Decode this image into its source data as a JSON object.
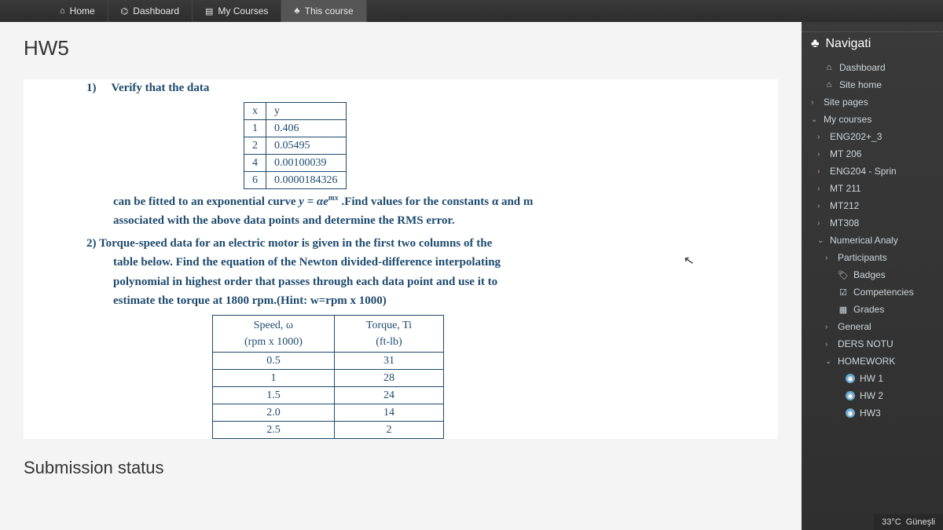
{
  "topnav": {
    "home": "Home",
    "dashboard": "Dashboard",
    "my_courses": "My Courses",
    "this_course": "This course"
  },
  "page_title": "HW5",
  "q1": {
    "num": "1)",
    "intro": "Verify that the data",
    "table": {
      "h1": "x",
      "h2": "y",
      "rows": [
        {
          "x": "1",
          "y": "0.406"
        },
        {
          "x": "2",
          "y": "0.05495"
        },
        {
          "x": "4",
          "y": "0.00100039"
        },
        {
          "x": "6",
          "y": "0.0000184326"
        }
      ]
    },
    "line1a": "can be fitted to an exponential curve ",
    "formula": "y = αe",
    "exp": "mx",
    "line1b": " .Find values for the constants α and m",
    "line2": "associated with the above data points and determine the RMS error."
  },
  "q2": {
    "num": "2)",
    "line1": "Torque-speed data for an electric motor is given in the first two columns of the",
    "line2": "table below. Find the equation of the Newton divided-difference interpolating",
    "line3": "polynomial in highest order that passes through each data point and use it to",
    "line4": "estimate the torque at 1800 rpm.(Hint: w=rpm x 1000)",
    "table": {
      "h1a": "Speed, ω",
      "h1b": "(rpm x 1000)",
      "h2a": "Torque, Ti",
      "h2b": "(ft-lb)",
      "rows": [
        {
          "s": "0.5",
          "t": "31"
        },
        {
          "s": "1",
          "t": "28"
        },
        {
          "s": "1.5",
          "t": "24"
        },
        {
          "s": "2.0",
          "t": "14"
        },
        {
          "s": "2.5",
          "t": "2"
        }
      ]
    }
  },
  "submission_heading": "Submission status",
  "sidebar": {
    "title": "Navigati",
    "items": [
      {
        "label": "Dashboard",
        "icon": "⌂",
        "chev": "",
        "indent": 0
      },
      {
        "label": "Site home",
        "icon": "⌂",
        "chev": "",
        "indent": 0
      },
      {
        "label": "Site pages",
        "icon": "",
        "chev": "right",
        "indent": 0
      },
      {
        "label": "My courses",
        "icon": "",
        "chev": "down",
        "indent": 0
      },
      {
        "label": "ENG202+_3",
        "icon": "",
        "chev": "right",
        "indent": 1
      },
      {
        "label": "MT 206",
        "icon": "",
        "chev": "right",
        "indent": 1
      },
      {
        "label": "ENG204 - Sprin",
        "icon": "",
        "chev": "right",
        "indent": 1
      },
      {
        "label": "MT 211",
        "icon": "",
        "chev": "right",
        "indent": 1
      },
      {
        "label": "MT212",
        "icon": "",
        "chev": "right",
        "indent": 1
      },
      {
        "label": "MT308",
        "icon": "",
        "chev": "right",
        "indent": 1
      },
      {
        "label": "Numerical Analy",
        "icon": "",
        "chev": "down",
        "indent": 1
      },
      {
        "label": "Participants",
        "icon": "",
        "chev": "right",
        "indent": 2
      },
      {
        "label": "Badges",
        "icon": "🏷",
        "chev": "",
        "indent": 2
      },
      {
        "label": "Competencies",
        "icon": "☑",
        "chev": "",
        "indent": 2
      },
      {
        "label": "Grades",
        "icon": "▦",
        "chev": "",
        "indent": 2
      },
      {
        "label": "General",
        "icon": "",
        "chev": "right",
        "indent": 2
      },
      {
        "label": "DERS NOTU",
        "icon": "",
        "chev": "right",
        "indent": 2
      },
      {
        "label": "HOMEWORK",
        "icon": "",
        "chev": "down",
        "indent": 2
      },
      {
        "label": "HW 1",
        "icon": "badge",
        "chev": "",
        "indent": 3
      },
      {
        "label": "HW 2",
        "icon": "badge",
        "chev": "",
        "indent": 3
      },
      {
        "label": "HW3",
        "icon": "badge",
        "chev": "",
        "indent": 3
      }
    ]
  },
  "taskbar": {
    "temp": "33°C",
    "weather": "Güneşli"
  }
}
